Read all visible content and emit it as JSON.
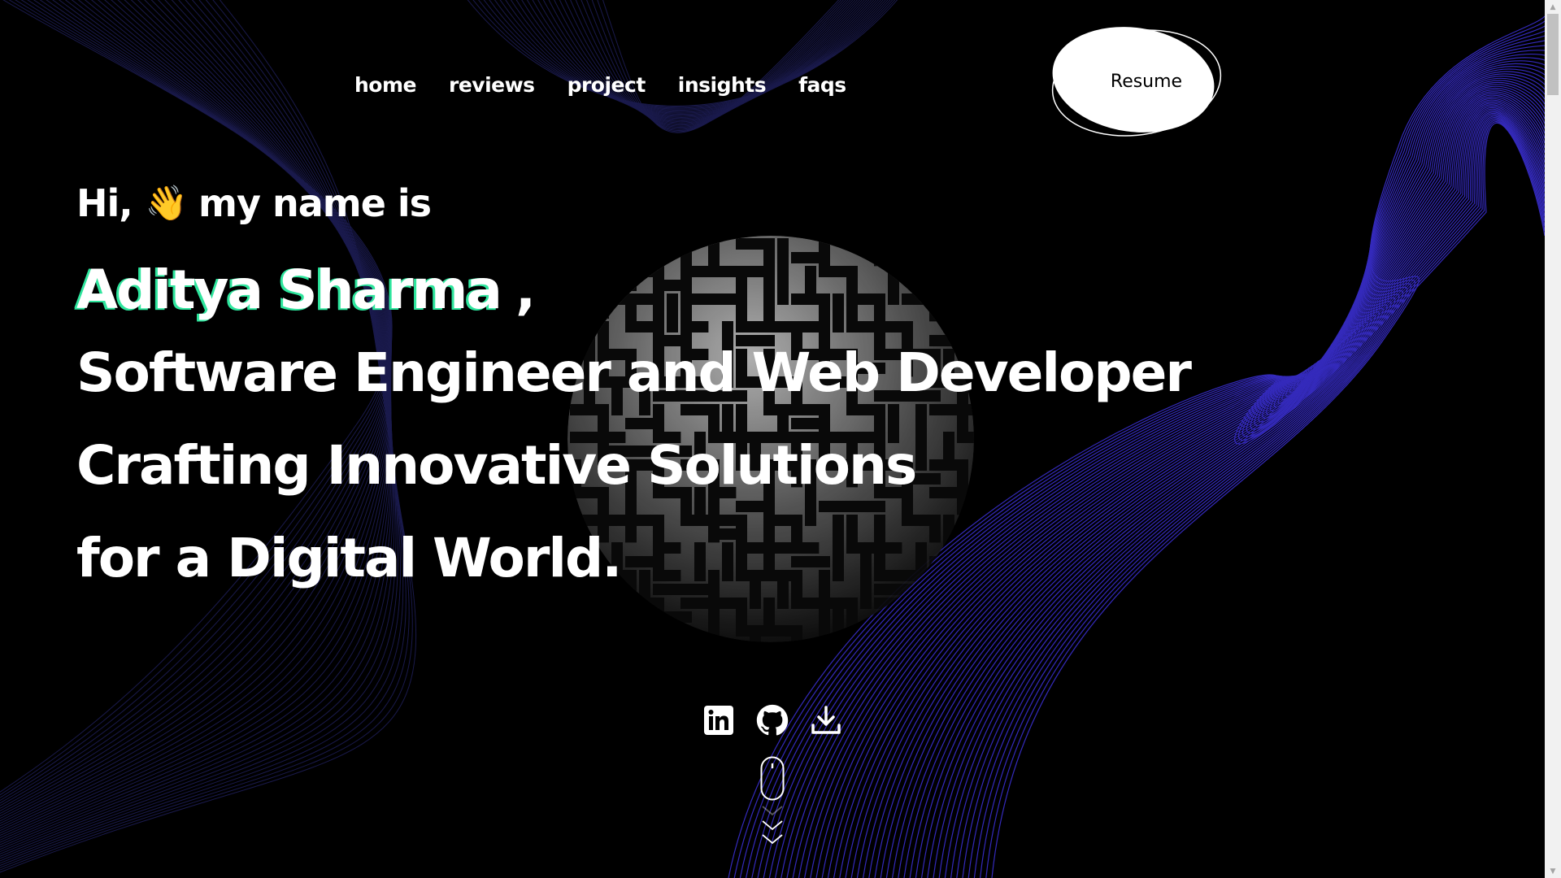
{
  "nav": {
    "items": [
      {
        "label": "home"
      },
      {
        "label": "reviews"
      },
      {
        "label": "project"
      },
      {
        "label": "insights"
      },
      {
        "label": "faqs"
      }
    ],
    "resume_label": "Resume"
  },
  "hero": {
    "greeting_prefix": "Hi,",
    "wave_emoji": "👋",
    "greeting_suffix": "my name is",
    "name": "Aditya Sharma",
    "comma": ",",
    "line1": "Software Engineer and Web Developer",
    "line2": "Crafting Innovative Solutions",
    "line3": "for a Digital World."
  },
  "socials": [
    {
      "icon": "linkedin-icon"
    },
    {
      "icon": "github-icon"
    },
    {
      "icon": "download-icon"
    }
  ],
  "colors": {
    "background": "#000000",
    "text": "#ffffff",
    "name_accent": "#2ee59d",
    "wave_lines": "#3a2fd0"
  }
}
